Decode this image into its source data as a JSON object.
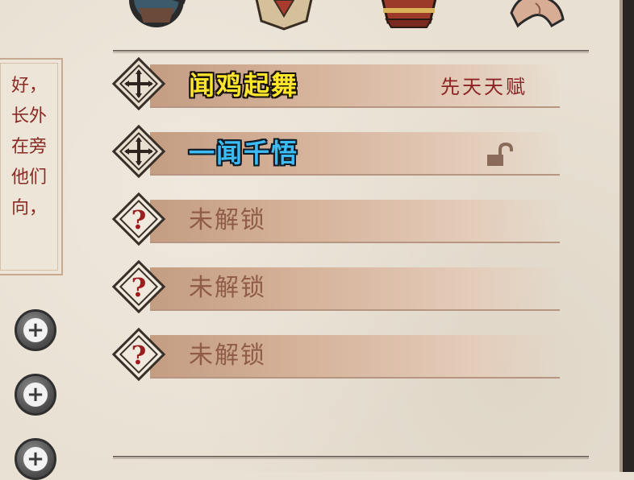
{
  "top_icons": [
    {
      "name": "character-portrait-icon",
      "color": "#3d5a6b"
    },
    {
      "name": "shield-emblem-icon",
      "color": "#b8a27a"
    },
    {
      "name": "red-chest-icon",
      "color": "#9c3a2a"
    },
    {
      "name": "muscular-arm-icon",
      "color": "#caa08a"
    }
  ],
  "side_text": {
    "lines": [
      "好，",
      "长外",
      "在旁",
      "他们",
      "向，"
    ]
  },
  "plus_buttons": [
    {
      "glyph": "+"
    },
    {
      "glyph": "+"
    },
    {
      "glyph": "+"
    }
  ],
  "talents": [
    {
      "name": "闻鸡起舞",
      "style": "yellow",
      "tag": "先天天赋",
      "badge": "cross-badge-icon"
    },
    {
      "name": "一闻千悟",
      "style": "blue",
      "tag": "",
      "badge": "cross-badge-icon",
      "unlocked_icon": "unlock-icon"
    },
    {
      "name": "未解锁",
      "style": "locked",
      "tag": "",
      "badge": "question-badge-icon"
    },
    {
      "name": "未解锁",
      "style": "locked",
      "tag": "",
      "badge": "question-badge-icon"
    },
    {
      "name": "未解锁",
      "style": "locked",
      "tag": "",
      "badge": "question-badge-icon"
    }
  ],
  "colors": {
    "parchment": "#e8e0d2",
    "accent_red": "#8b2424",
    "yellow_text": "#ffe62a",
    "blue_text": "#3cbcf6",
    "locked_text": "#8e5c48"
  }
}
